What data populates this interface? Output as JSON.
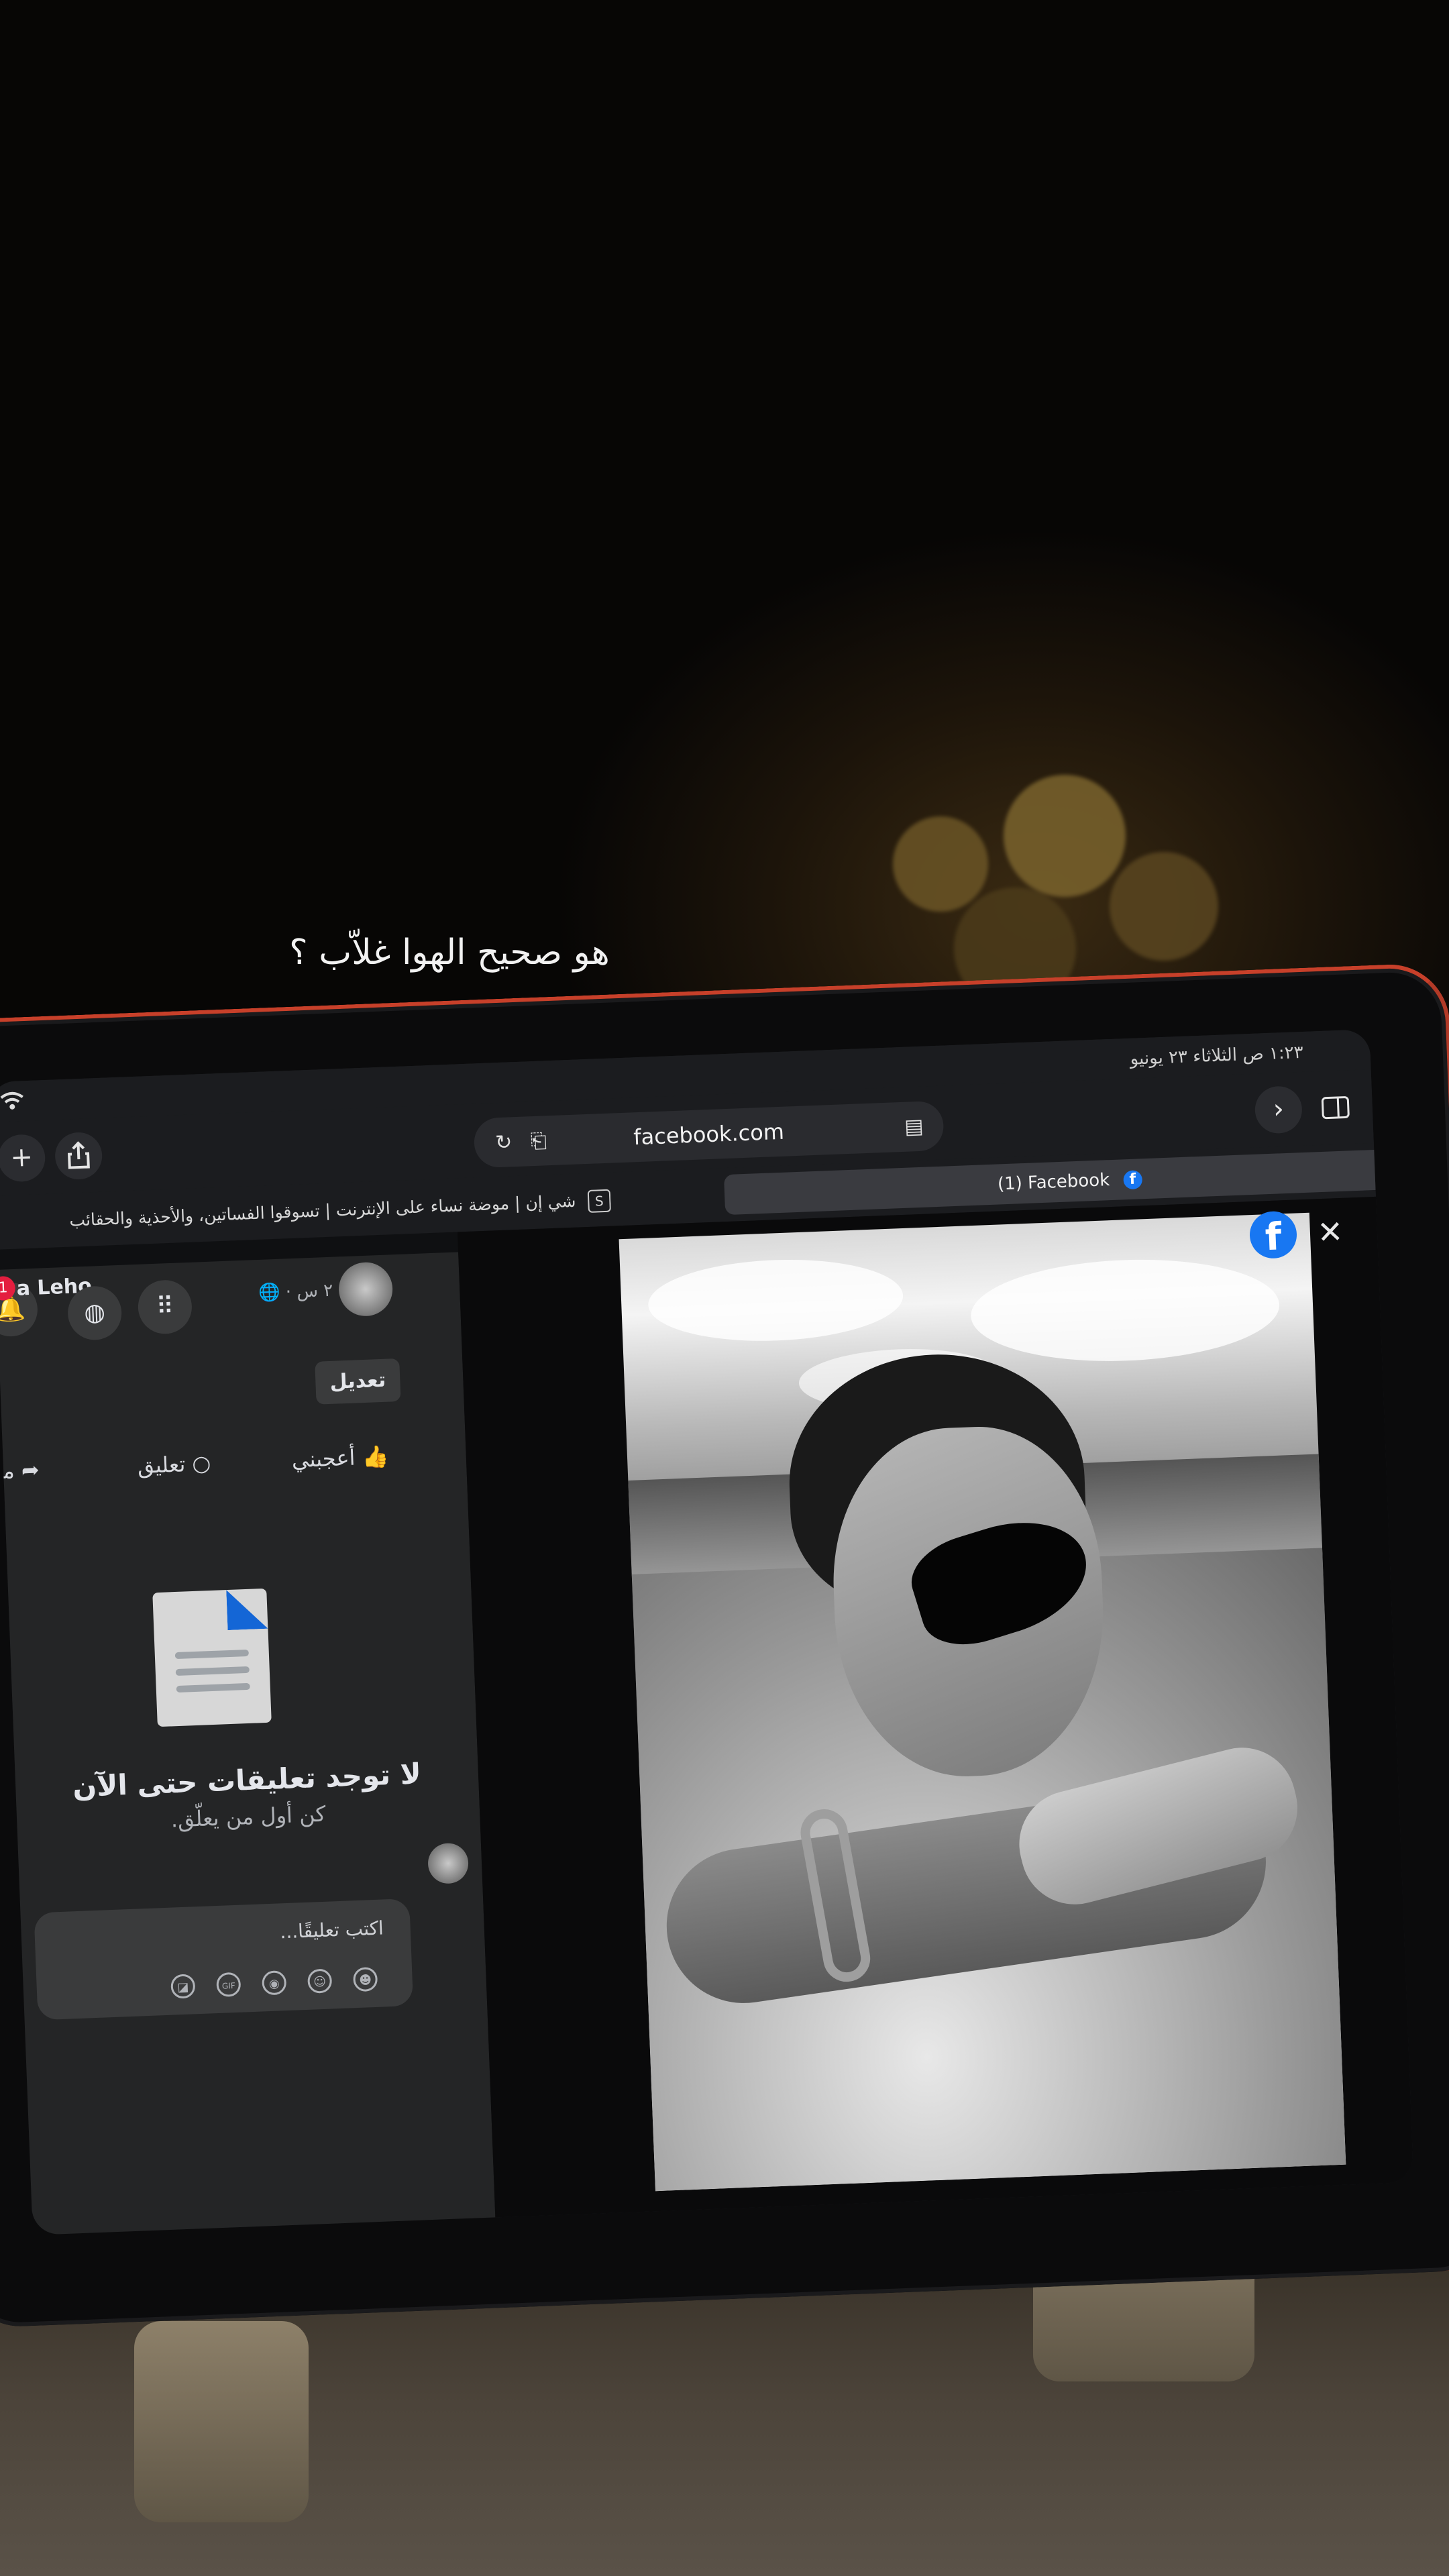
{
  "caption": "هو صحيح الهوا غلاّب ؟",
  "status": {
    "time": "١:٢٣ ص  الثلاثاء ٢٣ يونيو"
  },
  "toolbar": {
    "url": "facebook.com",
    "new_tab": "+",
    "forward": "›"
  },
  "tabs": {
    "inactive": "شي إن | موضة نساء على الإنترنت | تسوقوا الفساتين، والأحذية والحقائب",
    "active": "(1) Facebook"
  },
  "profile": {
    "name_fragment": "a Leho",
    "notification_count": "1",
    "post_time": "٢ س ·"
  },
  "post": {
    "edit_label": "تعديل",
    "like_label": "أعجبني",
    "comment_label": "تعليق",
    "share_fragment": "مـ"
  },
  "comments": {
    "empty_title": "لا توجد تعليقات حتى الآن",
    "empty_subtitle": "كن أول من يعلّق.",
    "placeholder": "اكتب تعليقًا...",
    "gif_label": "GIF"
  },
  "viewer": {
    "fb_letter": "f",
    "close_symbol": "✕"
  },
  "icons": [
    "wifi-icon",
    "plus-icon",
    "share-icon",
    "reload-icon",
    "extension-icon",
    "reader-icon",
    "forward-icon",
    "sidebar-icon",
    "shein-icon",
    "facebook-icon",
    "tab-close-icon",
    "bell-icon",
    "messenger-icon",
    "menu-grid-icon",
    "globe-icon",
    "like-icon",
    "comment-icon",
    "share-arrow-icon",
    "document-icon",
    "sticker-icon",
    "gif-icon",
    "camera-icon",
    "emoji-icon",
    "avatar-icon",
    "close-icon"
  ]
}
